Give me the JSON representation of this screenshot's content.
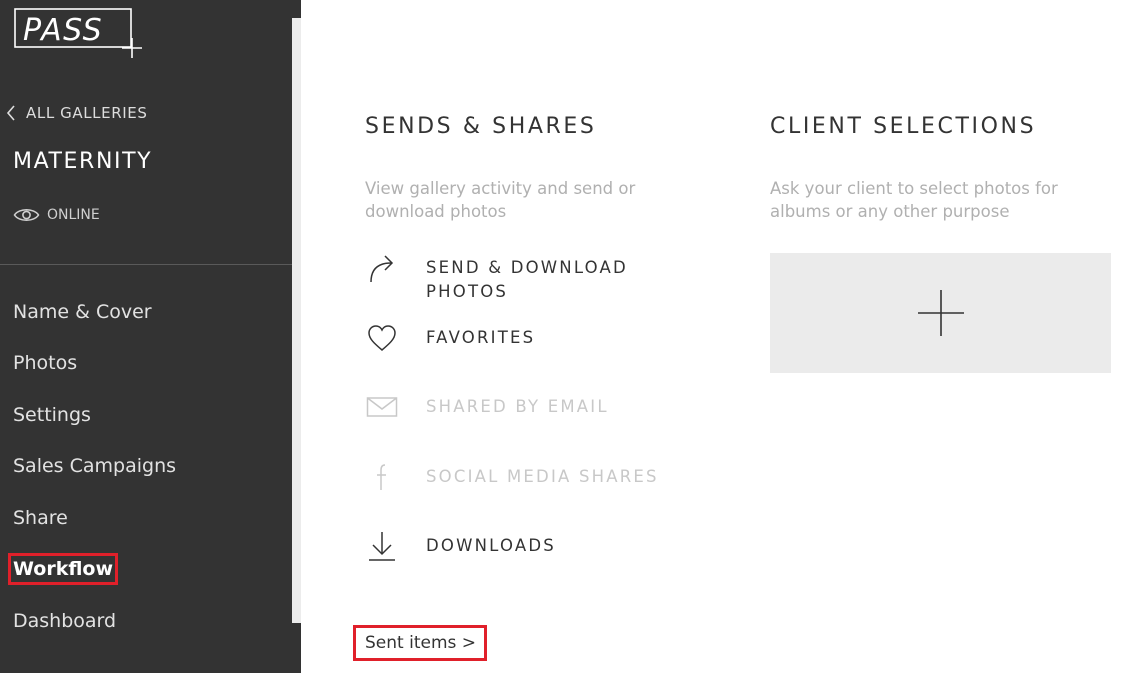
{
  "sidebar": {
    "logo_text": "PASS",
    "back_label": "ALL GALLERIES",
    "gallery_title": "MATERNITY",
    "status_label": "ONLINE",
    "nav": [
      {
        "label": "Name & Cover",
        "active": false
      },
      {
        "label": "Photos",
        "active": false
      },
      {
        "label": "Settings",
        "active": false
      },
      {
        "label": "Sales Campaigns",
        "active": false
      },
      {
        "label": "Share",
        "active": false
      },
      {
        "label": "Workflow",
        "active": true
      },
      {
        "label": "Dashboard",
        "active": false
      }
    ]
  },
  "sends_shares": {
    "title": "SENDS & SHARES",
    "description": "View gallery activity and send or download photos",
    "actions": [
      {
        "label": "SEND & DOWNLOAD PHOTOS",
        "icon": "share-arrow-icon",
        "enabled": true
      },
      {
        "label": "FAVORITES",
        "icon": "heart-icon",
        "enabled": true
      },
      {
        "label": "SHARED BY EMAIL",
        "icon": "envelope-icon",
        "enabled": false
      },
      {
        "label": "SOCIAL MEDIA SHARES",
        "icon": "facebook-icon",
        "enabled": false
      },
      {
        "label": "DOWNLOADS",
        "icon": "download-icon",
        "enabled": true
      }
    ],
    "sent_items_label": "Sent items >"
  },
  "client_selections": {
    "title": "CLIENT SELECTIONS",
    "description": "Ask your client to select photos for albums or any other purpose",
    "add_icon": "plus-icon"
  },
  "colors": {
    "sidebar_bg": "#333333",
    "highlight": "#e0202a",
    "tile_bg": "#ebebeb"
  }
}
